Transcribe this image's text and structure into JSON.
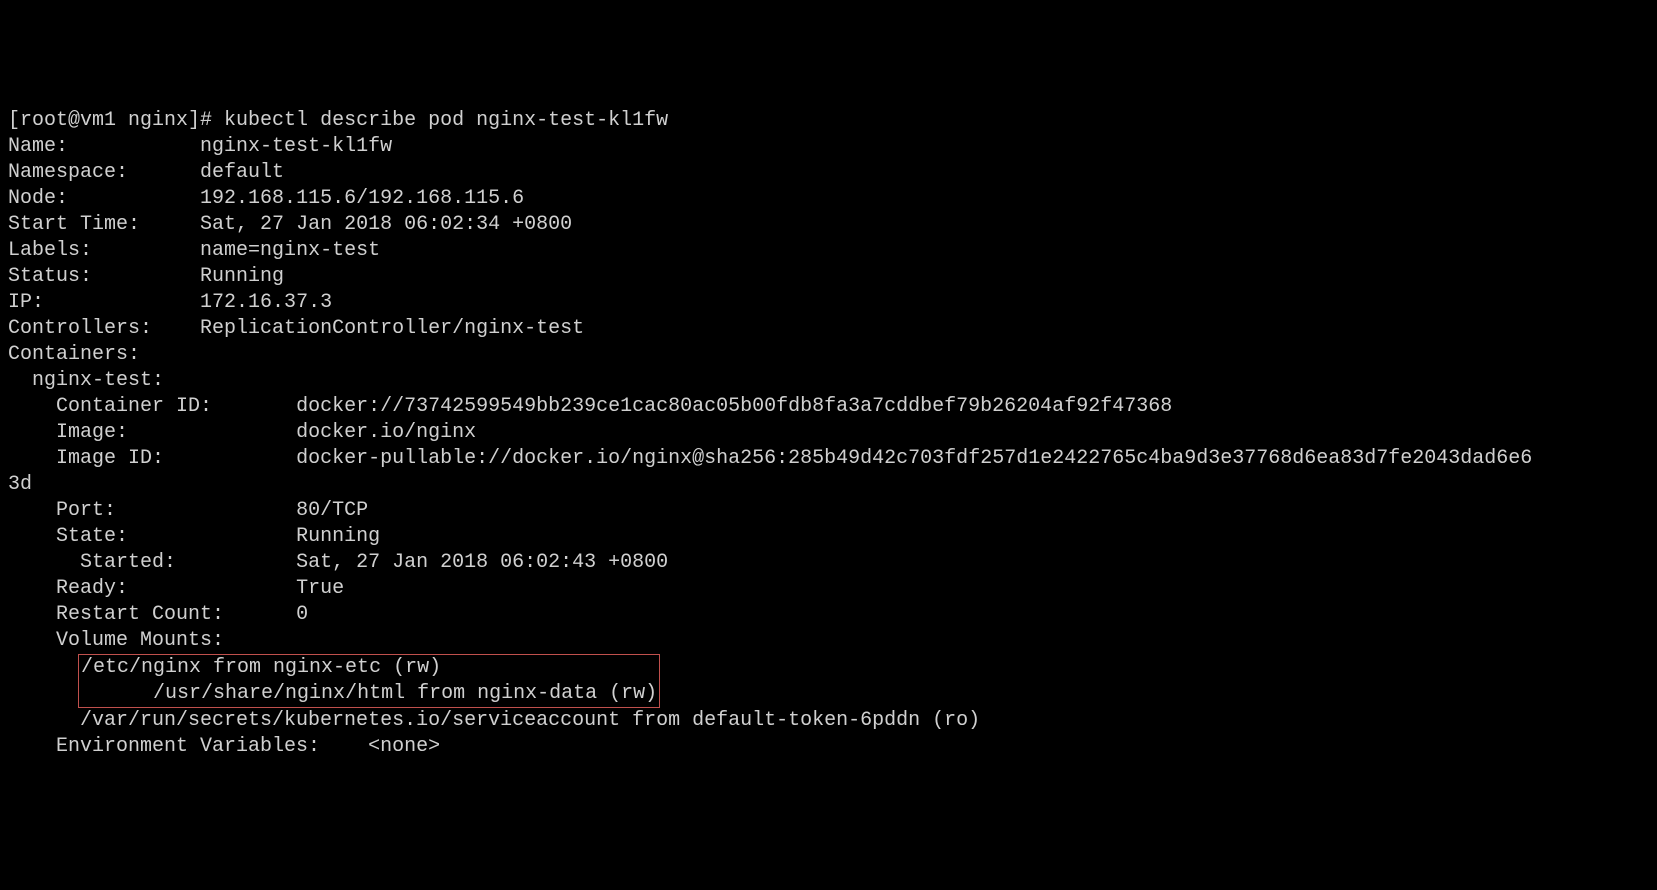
{
  "prompt": "[root@vm1 nginx]# ",
  "command": "kubectl describe pod nginx-test-kl1fw",
  "fields": {
    "name": {
      "label": "Name:",
      "value": "nginx-test-kl1fw"
    },
    "namespace": {
      "label": "Namespace:",
      "value": "default"
    },
    "node": {
      "label": "Node:",
      "value": "192.168.115.6/192.168.115.6"
    },
    "start_time": {
      "label": "Start Time:",
      "value": "Sat, 27 Jan 2018 06:02:34 +0800"
    },
    "labels": {
      "label": "Labels:",
      "value": "name=nginx-test"
    },
    "status": {
      "label": "Status:",
      "value": "Running"
    },
    "ip": {
      "label": "IP:",
      "value": "172.16.37.3"
    },
    "controllers": {
      "label": "Controllers:",
      "value": "ReplicationController/nginx-test"
    }
  },
  "containers_label": "Containers:",
  "container_name": "nginx-test:",
  "container": {
    "container_id": {
      "label": "Container ID:",
      "value": "docker://73742599549bb239ce1cac80ac05b00fdb8fa3a7cddbef79b26204af92f47368"
    },
    "image": {
      "label": "Image:",
      "value": "docker.io/nginx"
    },
    "image_id": {
      "label": "Image ID:",
      "value": "docker-pullable://docker.io/nginx@sha256:285b49d42c703fdf257d1e2422765c4ba9d3e37768d6ea83d7fe2043dad6e6"
    },
    "image_id_wrap": "3d",
    "port": {
      "label": "Port:",
      "value": "80/TCP"
    },
    "state": {
      "label": "State:",
      "value": "Running"
    },
    "started": {
      "label": "Started:",
      "value": "Sat, 27 Jan 2018 06:02:43 +0800"
    },
    "ready": {
      "label": "Ready:",
      "value": "True"
    },
    "restart_count": {
      "label": "Restart Count:",
      "value": "0"
    },
    "volume_mounts_label": "Volume Mounts:",
    "mounts": {
      "m1": "/etc/nginx from nginx-etc (rw)",
      "m2": "/usr/share/nginx/html from nginx-data (rw)",
      "m3": "/var/run/secrets/kubernetes.io/serviceaccount from default-token-6pddn (ro)"
    },
    "env_vars": {
      "label": "Environment Variables:",
      "value": "<none>"
    }
  }
}
